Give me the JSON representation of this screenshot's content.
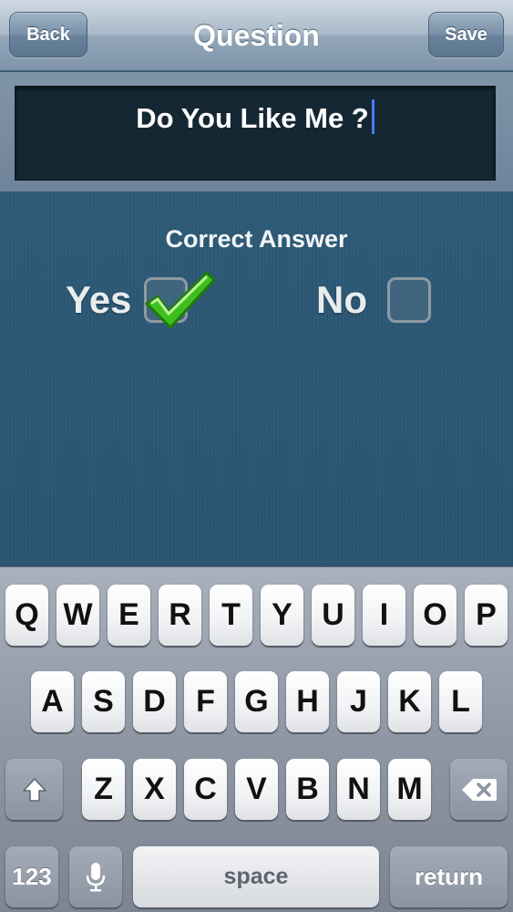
{
  "nav": {
    "title": "Question",
    "back_label": "Back",
    "save_label": "Save"
  },
  "question": {
    "text": "Do You Like Me ?"
  },
  "answer": {
    "label": "Correct Answer",
    "options": [
      {
        "label": "Yes",
        "checked": true
      },
      {
        "label": "No",
        "checked": false
      }
    ]
  },
  "keyboard": {
    "row1": [
      "Q",
      "W",
      "E",
      "R",
      "T",
      "Y",
      "U",
      "I",
      "O",
      "P"
    ],
    "row2": [
      "A",
      "S",
      "D",
      "F",
      "G",
      "H",
      "J",
      "K",
      "L"
    ],
    "row3": [
      "Z",
      "X",
      "C",
      "V",
      "B",
      "N",
      "M"
    ],
    "numbers_label": "123",
    "space_label": "space",
    "return_label": "return",
    "shift_icon": "shift-icon",
    "mic_icon": "microphone-icon",
    "delete_icon": "backspace-icon"
  },
  "colors": {
    "checkmark": "#3fbf1f",
    "caret": "#4a7dff",
    "background": "#2e5a76"
  }
}
